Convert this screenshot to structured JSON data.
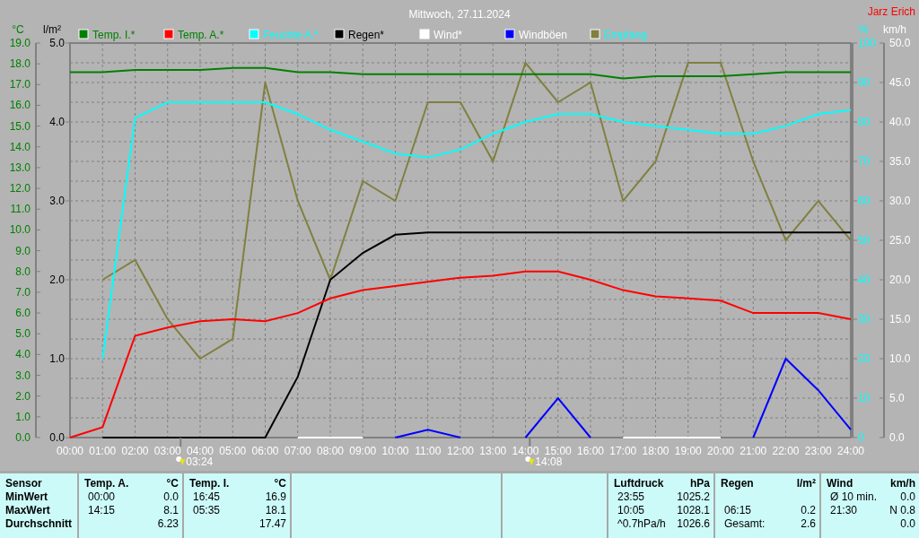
{
  "header": {
    "title": "Mittwoch, 27.11.2024",
    "author": "Jarz Erich"
  },
  "chart": {
    "chart_data": {
      "type": "line",
      "legend": "top",
      "grid": true,
      "categories": [
        "00:00",
        "01:00",
        "02:00",
        "03:00",
        "04:00",
        "05:00",
        "06:00",
        "07:00",
        "08:00",
        "09:00",
        "10:00",
        "11:00",
        "12:00",
        "13:00",
        "14:00",
        "15:00",
        "16:00",
        "17:00",
        "18:00",
        "19:00",
        "20:00",
        "21:00",
        "22:00",
        "23:00",
        "24:00"
      ],
      "ylabel": "°C",
      "ylim": [
        0,
        19
      ],
      "yticks": [
        {
          "value": 0,
          "label": "0.0"
        },
        {
          "value": 1,
          "label": "1.0"
        },
        {
          "value": 2,
          "label": "2.0"
        },
        {
          "value": 3,
          "label": "3.0"
        },
        {
          "value": 4,
          "label": "4.0"
        },
        {
          "value": 5,
          "label": "5.0"
        },
        {
          "value": 6,
          "label": "6.0"
        },
        {
          "value": 7,
          "label": "7.0"
        },
        {
          "value": 8,
          "label": "8.0"
        },
        {
          "value": 9,
          "label": "9.0"
        },
        {
          "value": 10,
          "label": "10.0"
        },
        {
          "value": 11,
          "label": "11.0"
        },
        {
          "value": 12,
          "label": "12.0"
        },
        {
          "value": 13,
          "label": "13.0"
        },
        {
          "value": 14,
          "label": "14.0"
        },
        {
          "value": 15,
          "label": "15.0"
        },
        {
          "value": 16,
          "label": "16.0"
        },
        {
          "value": 17,
          "label": "17.0"
        },
        {
          "value": 18,
          "label": "18.0"
        },
        {
          "value": 19,
          "label": "19.0"
        }
      ],
      "y2label": "%",
      "y2lim": [
        0,
        100
      ],
      "y2ticks": [
        0,
        10,
        20,
        30,
        40,
        50,
        60,
        70,
        80,
        90,
        100
      ],
      "y3label": "l/m²",
      "y3lim": [
        0,
        5
      ],
      "y3ticks": [
        {
          "value": 0,
          "label": "0.0"
        },
        {
          "value": 1,
          "label": "1.0"
        },
        {
          "value": 2,
          "label": "2.0"
        },
        {
          "value": 3,
          "label": "3.0"
        },
        {
          "value": 4,
          "label": "4.0"
        },
        {
          "value": 5,
          "label": "5.0"
        }
      ],
      "series": [
        {
          "name": "Temp. I.*",
          "color": "#008000",
          "values": [
            17.6,
            17.6,
            17.7,
            17.7,
            17.7,
            17.8,
            17.8,
            17.6,
            17.6,
            17.5,
            17.5,
            17.5,
            17.5,
            17.5,
            17.5,
            17.5,
            17.5,
            17.3,
            17.4,
            17.4,
            17.4,
            17.5,
            17.6,
            17.6,
            17.6
          ]
        },
        {
          "name": "Temp. A.*",
          "color": "#ff0000",
          "values": [
            0,
            0.5,
            4.9,
            5.3,
            5.6,
            5.7,
            5.6,
            6.0,
            6.7,
            7.1,
            7.3,
            7.5,
            7.7,
            7.8,
            8.0,
            8.0,
            7.6,
            7.1,
            6.8,
            6.7,
            6.6,
            6.0,
            6.0,
            6.0,
            5.7
          ]
        },
        {
          "name": "Feuchte A.*",
          "color": "#00ffff",
          "axis": "y2",
          "values": [
            null,
            20,
            81,
            85,
            85,
            85,
            85,
            82,
            78,
            75,
            72,
            71,
            73,
            77,
            80,
            82,
            82,
            80,
            79,
            78,
            77,
            77,
            79,
            82,
            83
          ]
        },
        {
          "name": "Regen*",
          "color": "#000000",
          "axis": "y3",
          "values": [
            null,
            0,
            0,
            0,
            0,
            0,
            0,
            0.77,
            2.0,
            2.34,
            2.57,
            2.6,
            2.6,
            2.6,
            2.6,
            2.6,
            2.6,
            2.6,
            2.6,
            2.6,
            2.6,
            2.6,
            2.6,
            2.6,
            2.6
          ]
        }
      ]
    },
    "markers": [
      {
        "time": "03:24"
      },
      {
        "time": "14:08"
      }
    ]
  },
  "overlay_chart": {
    "chart_data": {
      "type": "line",
      "legend": "top",
      "grid": true,
      "ylabel": "km/h",
      "ylim": [
        0,
        50
      ],
      "yticks": [
        {
          "value": 0,
          "label": "0.0"
        },
        {
          "value": 5,
          "label": "5.0"
        },
        {
          "value": 10,
          "label": "10.0"
        },
        {
          "value": 15,
          "label": "15.0"
        },
        {
          "value": 20,
          "label": "20.0"
        },
        {
          "value": 25,
          "label": "25.0"
        },
        {
          "value": 30,
          "label": "30.0"
        },
        {
          "value": 35,
          "label": "35.0"
        },
        {
          "value": 40,
          "label": "40.0"
        },
        {
          "value": 45,
          "label": "45.0"
        },
        {
          "value": 50,
          "label": "50.0"
        }
      ],
      "y2lim": [
        0,
        100
      ],
      "series": [
        {
          "name": "Wind*",
          "color": "#ffffff",
          "values": [
            null,
            null,
            null,
            null,
            null,
            null,
            null,
            0,
            0,
            0,
            null,
            null,
            null,
            null,
            null,
            null,
            null,
            0,
            0,
            0,
            0,
            null,
            null,
            null,
            null
          ]
        },
        {
          "name": "Windböen",
          "color": "#0000ff",
          "values": [
            null,
            null,
            null,
            null,
            null,
            null,
            null,
            null,
            null,
            null,
            0,
            1,
            0,
            null,
            0,
            5,
            0,
            null,
            null,
            null,
            null,
            0,
            10,
            6,
            1
          ]
        },
        {
          "name": "Empfang",
          "color": "#808040",
          "axis": "y2",
          "values": [
            null,
            40,
            45,
            30,
            20,
            25,
            90,
            60,
            40,
            65,
            60,
            85,
            85,
            70,
            95,
            85,
            90,
            60,
            70,
            95,
            95,
            70,
            50,
            60,
            50
          ]
        }
      ]
    }
  },
  "table": {
    "sensor": {
      "title": "Sensor",
      "rows": [
        "MinWert",
        "MaxWert",
        "Durchschnitt"
      ]
    },
    "sections": [
      {
        "kind": "data",
        "title": "Temp. A.",
        "unit": "°C",
        "rows": [
          [
            "00:00",
            "0.0"
          ],
          [
            "14:15",
            "8.1"
          ],
          [
            null,
            "6.23"
          ]
        ]
      },
      {
        "kind": "data",
        "title": "Temp. I.",
        "unit": "°C",
        "rows": [
          [
            "16:45",
            "16.9"
          ],
          [
            "05:35",
            "18.1"
          ],
          [
            null,
            "17.47"
          ]
        ]
      },
      {
        "kind": "blank"
      },
      {
        "kind": "blank"
      },
      {
        "kind": "data",
        "title": "Luftdruck",
        "unit": "hPa",
        "rows": [
          [
            "23:55",
            "1025.2"
          ],
          [
            "10:05",
            "1028.1"
          ],
          [
            "^0.7hPa/h",
            "1026.6"
          ]
        ]
      },
      {
        "kind": "data",
        "title": "Regen",
        "unit": "l/m²",
        "rows": [
          [
            null,
            null
          ],
          [
            "06:15",
            "0.2"
          ],
          [
            "Gesamt:",
            "2.6"
          ]
        ]
      },
      {
        "kind": "data",
        "title": "Wind",
        "unit": "km/h",
        "rows": [
          [
            "Ø 10 min.",
            "0.0"
          ],
          [
            "21:30",
            "N 0.8"
          ],
          [
            null,
            "0.0"
          ]
        ]
      }
    ]
  }
}
